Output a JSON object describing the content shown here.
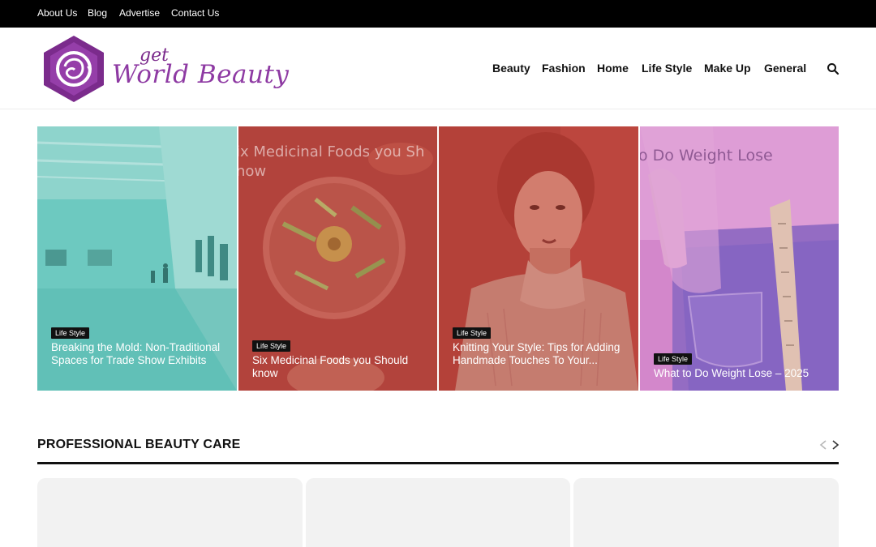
{
  "topbar": {
    "links": [
      "About Us",
      "Blog",
      "Advertise",
      "Contact Us"
    ]
  },
  "logo": {
    "small_text": "get",
    "main_text": "World Beauty",
    "icon": "woman-face-hexagon-logo"
  },
  "nav": {
    "items": [
      "Beauty",
      "Fashion",
      "Home",
      "Life Style",
      "Make Up",
      "General"
    ],
    "search_icon": "search-icon"
  },
  "slides": [
    {
      "category": "Life Style",
      "title": "Breaking the Mold: Non-Traditional Spaces for Trade Show Exhibits",
      "overlay_title": "",
      "tint": "#3fb2a9"
    },
    {
      "category": "Life Style",
      "title": "Six Medicinal Foods you Should know",
      "overlay_title": "ix Medicinal Foods you Sh\nnow",
      "tint": "#c0493f"
    },
    {
      "category": "Life Style",
      "title": "Knitting Your Style: Tips for Adding Handmade Touches To Your...",
      "overlay_title": "",
      "tint": "#b83d35"
    },
    {
      "category": "Life Style",
      "title": "What to Do Weight Lose – 2025",
      "overlay_title": "o Do  Weight Lose",
      "tint": "#b65cb0"
    }
  ],
  "section": {
    "title": "PROFESSIONAL BEAUTY CARE",
    "prev_icon": "chevron-left-icon",
    "next_icon": "chevron-right-icon"
  },
  "colors": {
    "brand": "#8e3aa3",
    "topbar": "#000000",
    "card_bg": "#f2f2f2"
  }
}
